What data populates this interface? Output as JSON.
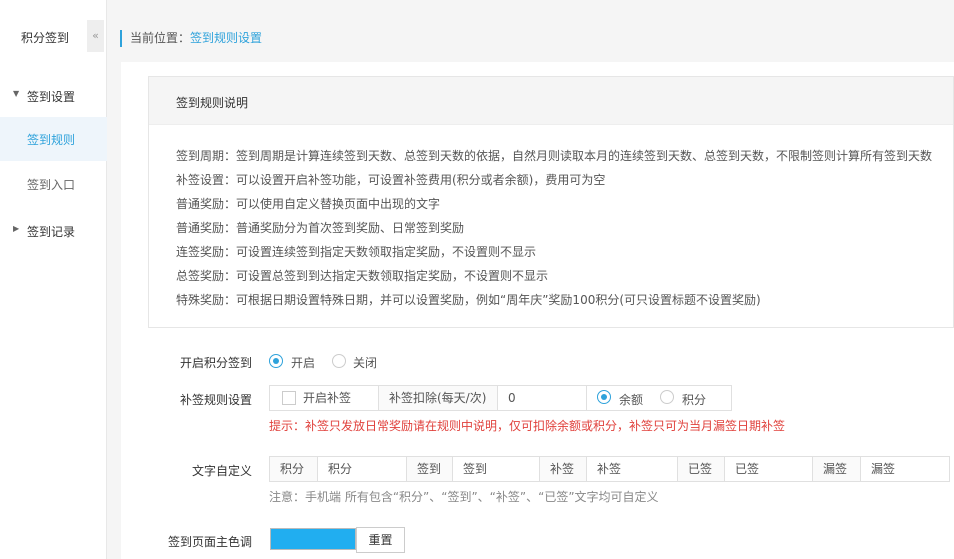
{
  "sidebar": {
    "title": "积分签到",
    "collapse_icon": "«",
    "groups": [
      {
        "label": "签到设置",
        "expanded": true
      },
      {
        "label": "签到记录",
        "expanded": false
      }
    ],
    "items": [
      {
        "label": "签到规则",
        "active": true
      },
      {
        "label": "签到入口",
        "active": false
      }
    ]
  },
  "breadcrumb": {
    "prefix": "当前位置：",
    "current": "签到规则设置"
  },
  "rules": {
    "title": "签到规则说明",
    "lines": [
      "签到周期：签到周期是计算连续签到天数、总签到天数的依据，自然月则读取本月的连续签到天数、总签到天数，不限制签则计算所有签到天数",
      "补签设置：可以设置开启补签功能，可设置补签费用(积分或者余额)，费用可为空",
      "普通奖励：可以使用自定义替换页面中出现的文字",
      "普通奖励：普通奖励分为首次签到奖励、日常签到奖励",
      "连签奖励：可设置连续签到指定天数领取指定奖励，不设置则不显示",
      "总签奖励：可设置总签到到达指定天数领取指定奖励，不设置则不显示",
      "特殊奖励：可根据日期设置特殊日期，并可以设置奖励，例如“周年庆”奖励100积分(可只设置标题不设置奖励)"
    ]
  },
  "form": {
    "enable": {
      "label": "开启积分签到",
      "on_label": "开启",
      "off_label": "关闭",
      "value": "开启"
    },
    "makeup": {
      "label": "补签规则设置",
      "checkbox_label": "开启补签",
      "deduct_label": "补签扣除(每天/次)",
      "deduct_value": "0",
      "balance_label": "余额",
      "points_label": "积分",
      "selected": "余额",
      "hint": "提示：补签只发放日常奖励请在规则中说明，仅可扣除余额或积分，补签只可为当月漏签日期补签"
    },
    "text_custom": {
      "label": "文字自定义",
      "pairs": [
        {
          "name": "积分",
          "value": "积分"
        },
        {
          "name": "签到",
          "value": "签到"
        },
        {
          "name": "补签",
          "value": "补签"
        },
        {
          "name": "已签",
          "value": "已签"
        },
        {
          "name": "漏签",
          "value": "漏签"
        }
      ],
      "note": "注意：手机端 所有包含“积分”、“签到”、“补签”、“已签”文字均可自定义"
    },
    "theme": {
      "label": "签到页面主色调",
      "color": "#21aef0",
      "reset_label": "重置"
    }
  }
}
